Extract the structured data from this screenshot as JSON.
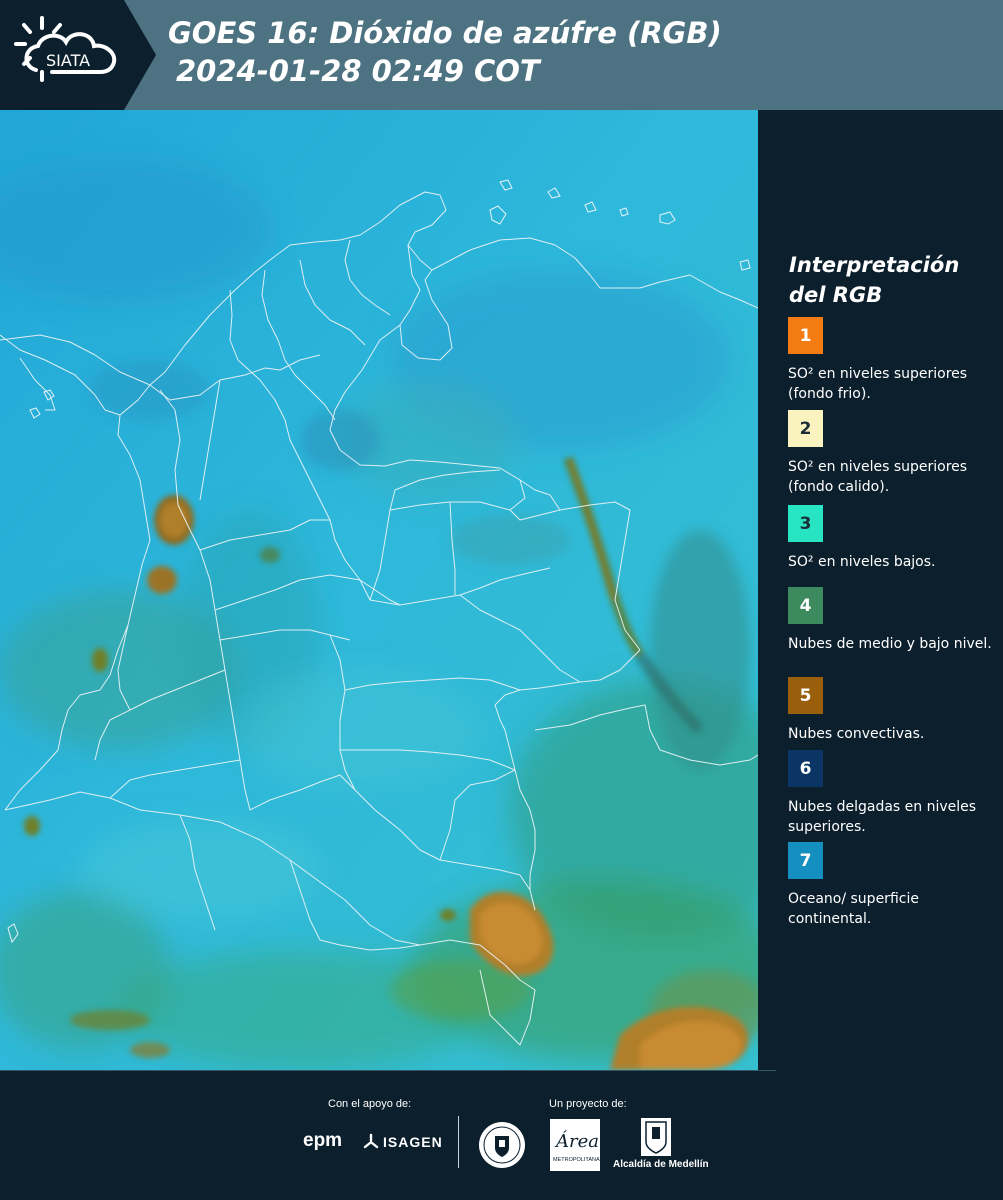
{
  "header": {
    "logo_text": "SIATA",
    "title_line1": "GOES 16: Dióxido de azúfre (RGB)",
    "title_line2": "2024-01-28 02:49 COT"
  },
  "map": {
    "background_color": "#2bb5d8",
    "border_color": "#e8f2f5"
  },
  "legend": {
    "title_line1": "Interpretación",
    "title_line2": "del RGB",
    "items": [
      {
        "number": "1",
        "color": "#f47a12",
        "number_color": "#ffffff",
        "text": "SO² en niveles superiores (fondo frio)."
      },
      {
        "number": "2",
        "color": "#fbf3bf",
        "number_color": "#1c2d38",
        "text": "SO² en niveles superiores (fondo calido)."
      },
      {
        "number": "3",
        "color": "#27e4c3",
        "number_color": "#1c2d38",
        "text": "SO² en niveles bajos."
      },
      {
        "number": "4",
        "color": "#3d8a5f",
        "number_color": "#ffffff",
        "text": "Nubes de medio y bajo nivel."
      },
      {
        "number": "5",
        "color": "#9a5f0c",
        "number_color": "#ffffff",
        "text": "Nubes convectivas."
      },
      {
        "number": "6",
        "color": "#0a3564",
        "number_color": "#ffffff",
        "text": "Nubes delgadas en niveles superiores."
      },
      {
        "number": "7",
        "color": "#158fc0",
        "number_color": "#ffffff",
        "text": "Oceano/ superficie continental."
      }
    ]
  },
  "footer": {
    "support_label": "Con el apoyo de:",
    "project_label": "Un proyecto de:",
    "epm": "epm",
    "isagen": "ISAGEN",
    "area_text": "Área",
    "area_sub": "METROPOLITANA",
    "alcaldia": "Alcaldía de Medellín"
  }
}
